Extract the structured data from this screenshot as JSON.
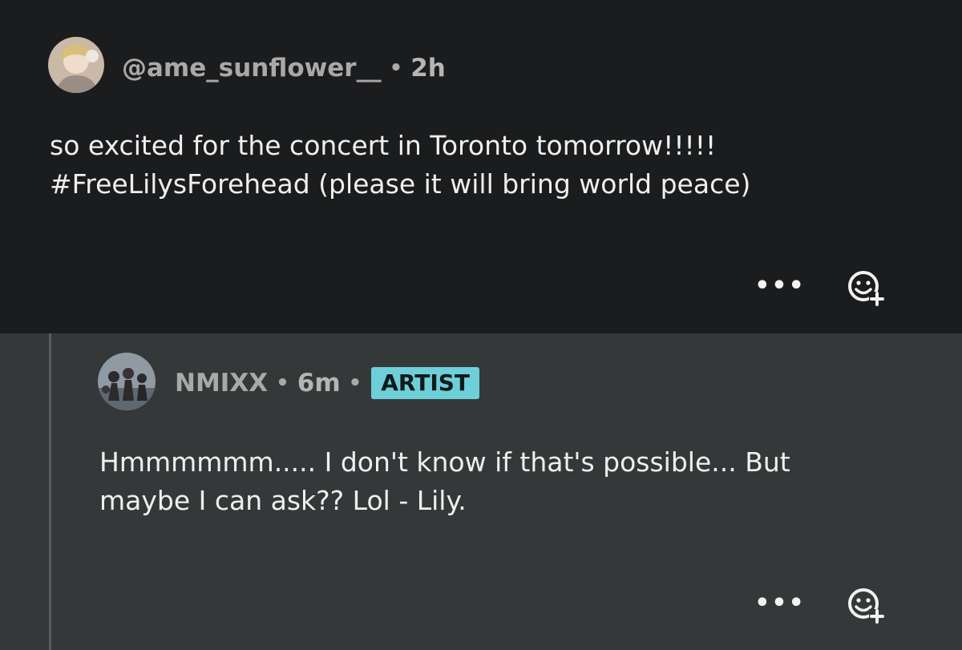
{
  "post": {
    "username": "@ame_sunflower__",
    "separator": "•",
    "time": "2h",
    "text": "so excited for the concert in Toronto tomorrow!!!!!\n#FreeLilysForehead (please it will bring world peace)",
    "actions": {
      "more_glyph": "•••",
      "more_icon": "ellipsis-icon",
      "react_icon": "add-reaction-icon"
    }
  },
  "reply": {
    "username": "NMIXX",
    "separator": "•",
    "time": "6m",
    "separator2": "•",
    "badge": "ARTIST",
    "text": "Hmmmmmm..... I don't know if that's possible... But\nmaybe I can ask?? Lol - Lily.",
    "actions": {
      "more_glyph": "•••",
      "more_icon": "ellipsis-icon",
      "react_icon": "add-reaction-icon"
    }
  },
  "colors": {
    "post_bg": "#1b1c1d",
    "reply_bg": "#353839",
    "badge_bg": "#6ecfd9",
    "meta_text": "#a9a9a9",
    "body_text": "#efefef"
  }
}
